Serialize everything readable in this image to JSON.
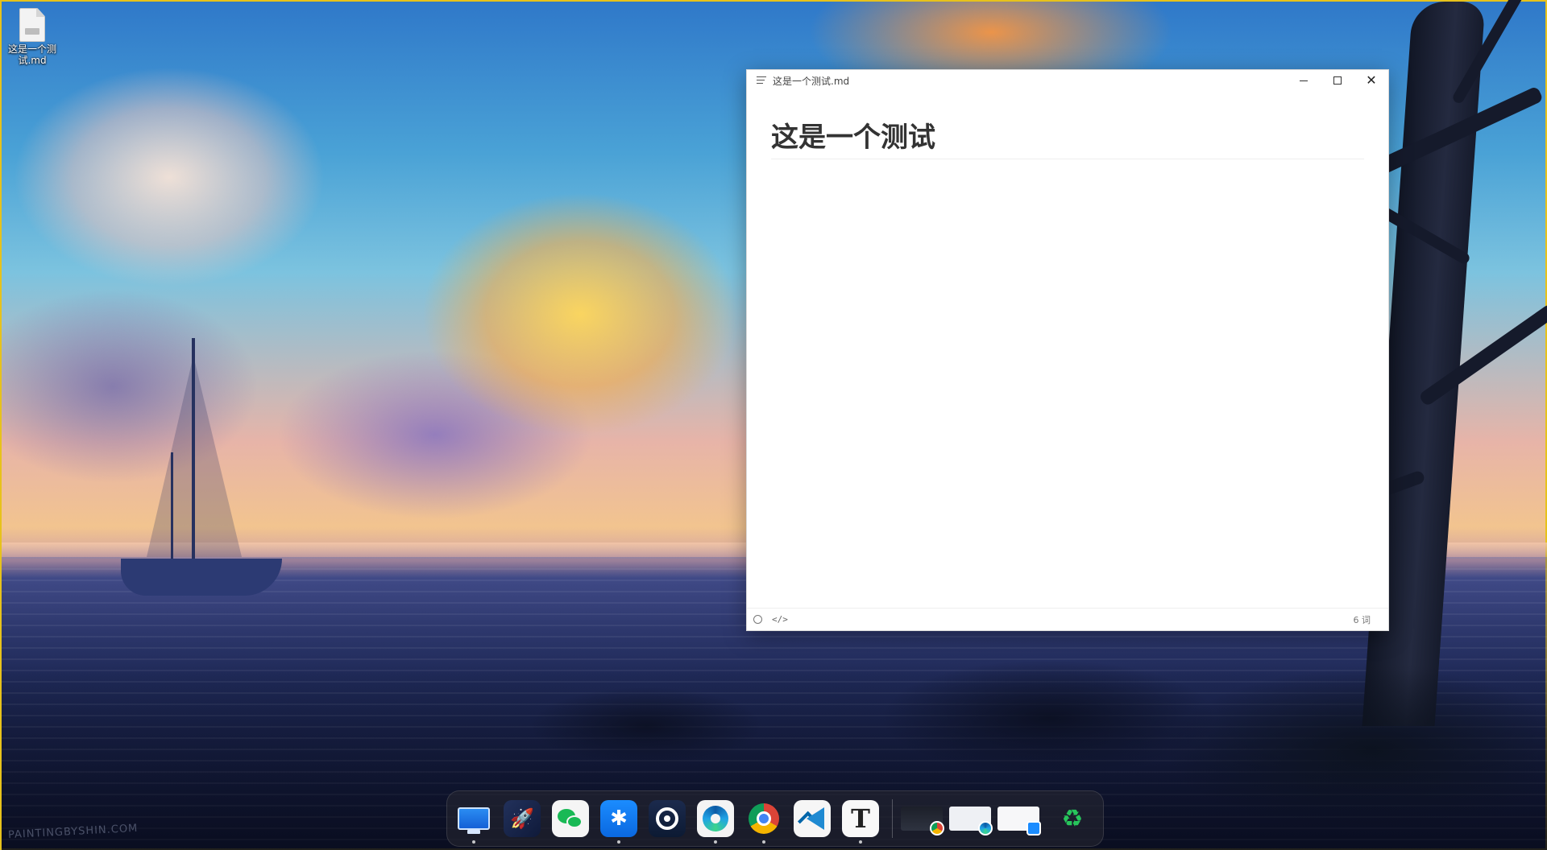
{
  "desktop": {
    "icon_label": "这是一个测试.md",
    "wallpaper_watermark": "PAINTINGBYSHIN.COM"
  },
  "window": {
    "title": "这是一个测试.md",
    "heading": "这是一个测试",
    "status": {
      "code_toggle": "</>",
      "word_count": "6 词"
    }
  },
  "dock": {
    "apps": [
      {
        "name": "desktop",
        "glyph": ""
      },
      {
        "name": "launcher",
        "glyph": "🚀"
      },
      {
        "name": "wechat",
        "glyph": ""
      },
      {
        "name": "app-store",
        "glyph": "✱"
      },
      {
        "name": "steam",
        "glyph": ""
      },
      {
        "name": "edge",
        "glyph": ""
      },
      {
        "name": "chrome",
        "glyph": ""
      },
      {
        "name": "vscode",
        "glyph": ""
      },
      {
        "name": "typora",
        "glyph": "T"
      }
    ],
    "recent_windows": [
      "chrome-window",
      "edge-window",
      "app-store-window"
    ],
    "trash_glyph": "♻"
  },
  "colors": {
    "accent_border": "#e7c21b",
    "window_bg": "#ffffff",
    "heading_text": "#333333"
  }
}
